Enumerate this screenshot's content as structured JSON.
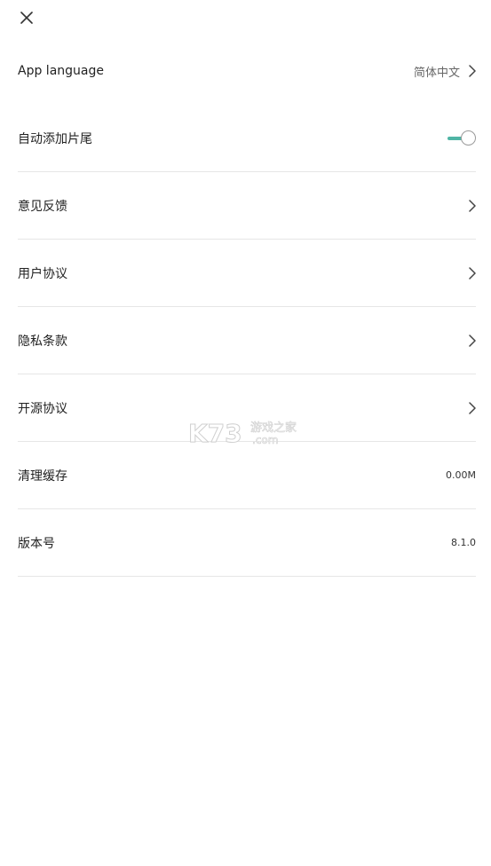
{
  "items": [
    {
      "label": "App language",
      "value": "简体中文",
      "type": "link"
    },
    {
      "label": "自动添加片尾",
      "value": "",
      "type": "toggle",
      "toggle_on": true
    },
    {
      "label": "意见反馈",
      "value": "",
      "type": "link"
    },
    {
      "label": "用户协议",
      "value": "",
      "type": "link"
    },
    {
      "label": "隐私条款",
      "value": "",
      "type": "link"
    },
    {
      "label": "开源协议",
      "value": "",
      "type": "link"
    },
    {
      "label": "清理缓存",
      "value": "0.00M",
      "type": "value"
    },
    {
      "label": "版本号",
      "value": "8.1.0",
      "type": "value"
    }
  ],
  "watermark": {
    "text": "K73",
    "subtext": "游戏之家",
    "domain": ".com"
  },
  "colors": {
    "accent": "#4fb5a5",
    "divider": "#e6e6e6",
    "text": "#222222"
  }
}
